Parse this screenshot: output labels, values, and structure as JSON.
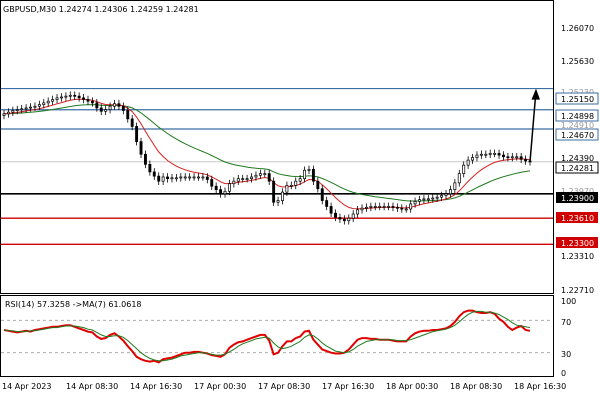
{
  "main_panel": {
    "symbol_info": "GBPUSD,M30  1.24274 1.24306 1.24259 1.24281",
    "price_ticks": [
      "1.26070",
      "1.25630",
      "1.24390",
      "1.23310",
      "1.22710"
    ],
    "faint_ticks": [
      "1.25230",
      "1.24910",
      "1.23970"
    ],
    "level_labels": {
      "l1": "1.25150",
      "l2": "1.24898",
      "l3": "1.24670",
      "current": "1.24281",
      "support": "1.23900",
      "r1": "1.23610",
      "r2": "1.23300"
    },
    "colors": {
      "bull": "#000000",
      "ma_fast": "#d62020",
      "ma_slow": "#1f7a1f",
      "level_blue": "#3a6ea5",
      "level_red": "#d00000",
      "level_black": "#000000"
    }
  },
  "rsi_panel": {
    "label": "RSI(14) 57.3258  ->MA(7) 61.0618",
    "ticks": [
      "100",
      "70",
      "30",
      "0"
    ],
    "colors": {
      "rsi": "#e00000",
      "ma": "#1f7a1f"
    }
  },
  "time_axis": [
    "14 Apr 2023",
    "14 Apr 08:30",
    "14 Apr 16:30",
    "17 Apr 00:30",
    "17 Apr 08:30",
    "17 Apr 16:30",
    "18 Apr 00:30",
    "18 Apr 08:30",
    "18 Apr 16:30"
  ],
  "chart_data": {
    "type": "candlestick",
    "x": [
      "14 Apr 2023",
      "14 Apr 08:30",
      "14 Apr 16:30",
      "17 Apr 00:30",
      "17 Apr 08:30",
      "17 Apr 16:30",
      "18 Apr 00:30",
      "18 Apr 08:30",
      "18 Apr 16:30"
    ],
    "closes": [
      1.2485,
      1.2487,
      1.2489,
      1.249,
      1.2491,
      1.2492,
      1.2493,
      1.2494,
      1.2496,
      1.2498,
      1.25,
      1.2502,
      1.2504,
      1.2505,
      1.2506,
      1.2507,
      1.2506,
      1.2504,
      1.2502,
      1.25,
      1.2498,
      1.2492,
      1.2488,
      1.249,
      1.2494,
      1.2497,
      1.2494,
      1.2489,
      1.2479,
      1.247,
      1.2452,
      1.2437,
      1.2425,
      1.2416,
      1.2411,
      1.2405,
      1.241,
      1.2408,
      1.2409,
      1.2409,
      1.241,
      1.241,
      1.241,
      1.241,
      1.241,
      1.241,
      1.2407,
      1.2399,
      1.2395,
      1.239,
      1.2393,
      1.2402,
      1.2405,
      1.2408,
      1.2408,
      1.2408,
      1.241,
      1.2412,
      1.2414,
      1.2414,
      1.2405,
      1.238,
      1.2382,
      1.2392,
      1.24,
      1.24,
      1.2405,
      1.2408,
      1.2418,
      1.2419,
      1.2405,
      1.2396,
      1.2382,
      1.2375,
      1.2367,
      1.2362,
      1.236,
      1.2358,
      1.2361,
      1.2366,
      1.2371,
      1.2373,
      1.2374,
      1.2375,
      1.2375,
      1.2375,
      1.2375,
      1.2375,
      1.2374,
      1.2373,
      1.2372,
      1.2372,
      1.2378,
      1.2381,
      1.2383,
      1.2384,
      1.2384,
      1.2385,
      1.2386,
      1.2388,
      1.239,
      1.2395,
      1.2403,
      1.2414,
      1.2424,
      1.243,
      1.2433,
      1.2436,
      1.2437,
      1.2437,
      1.2438,
      1.2438,
      1.2436,
      1.2434,
      1.2433,
      1.2434,
      1.2434,
      1.2431,
      1.2429,
      1.2428
    ],
    "series": [
      {
        "name": "RSI(14)",
        "values": [
          58,
          57,
          56,
          55,
          56,
          57,
          56,
          58,
          59,
          60,
          61,
          62,
          62,
          63,
          64,
          64,
          62,
          60,
          58,
          56,
          55,
          50,
          47,
          48,
          52,
          54,
          50,
          45,
          38,
          32,
          25,
          22,
          20,
          19,
          20,
          18,
          22,
          23,
          24,
          26,
          28,
          30,
          30,
          31,
          31,
          30,
          29,
          27,
          26,
          25,
          28,
          36,
          40,
          43,
          44,
          46,
          48,
          50,
          52,
          52,
          45,
          28,
          30,
          38,
          44,
          44,
          48,
          50,
          56,
          57,
          46,
          40,
          34,
          32,
          30,
          29,
          29,
          30,
          34,
          40,
          46,
          48,
          48,
          47,
          47,
          46,
          46,
          46,
          45,
          44,
          44,
          44,
          50,
          54,
          56,
          57,
          57,
          58,
          58,
          59,
          60,
          63,
          68,
          75,
          80,
          82,
          82,
          80,
          79,
          79,
          80,
          78,
          72,
          68,
          62,
          58,
          61,
          63,
          58,
          57
        ]
      },
      {
        "name": "MA(7)",
        "values": [
          58,
          57,
          57,
          56,
          56,
          56,
          57,
          57,
          58,
          59,
          60,
          61,
          61,
          62,
          63,
          63,
          63,
          62,
          61,
          59,
          58,
          55,
          52,
          50,
          50,
          51,
          51,
          49,
          45,
          40,
          35,
          30,
          26,
          23,
          21,
          20,
          20,
          21,
          22,
          24,
          26,
          27,
          28,
          29,
          30,
          30,
          29,
          28,
          27,
          27,
          28,
          31,
          34,
          38,
          41,
          43,
          45,
          47,
          48,
          49,
          48,
          42,
          37,
          35,
          36,
          38,
          41,
          44,
          49,
          52,
          51,
          47,
          42,
          38,
          35,
          32,
          31,
          30,
          31,
          34,
          38,
          41,
          44,
          45,
          46,
          46,
          46,
          46,
          46,
          45,
          45,
          45,
          46,
          48,
          50,
          52,
          54,
          56,
          57,
          58,
          59,
          61,
          64,
          68,
          73,
          77,
          80,
          81,
          81,
          80,
          80,
          79,
          77,
          74,
          71,
          67,
          64,
          63,
          62,
          61
        ]
      }
    ],
    "levels": [
      1.2515,
      1.24898,
      1.2467,
      1.239,
      1.2361,
      1.233
    ],
    "current_price": 1.24281,
    "projection_target": 1.2515,
    "y_ticks": [
      1.2607,
      1.2563,
      1.2439,
      1.2331,
      1.2271
    ],
    "rsi_ticks": [
      100,
      70,
      30,
      0
    ],
    "ylim": [
      1.2271,
      1.2619
    ],
    "rsi_ylim": [
      0,
      100
    ],
    "grid": false
  }
}
